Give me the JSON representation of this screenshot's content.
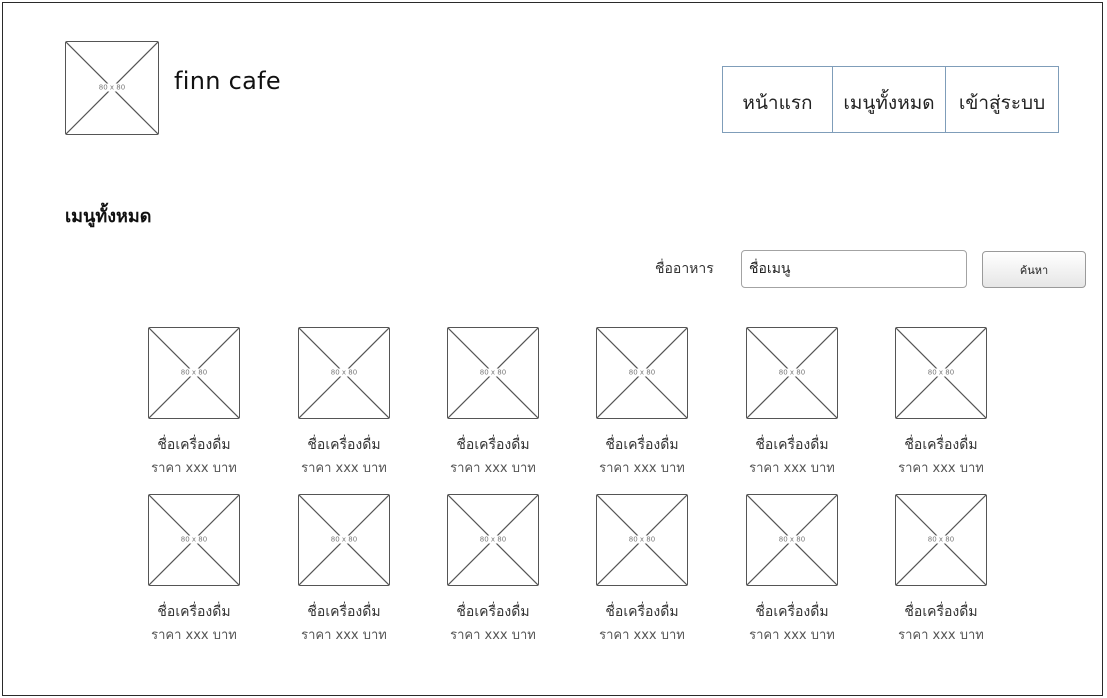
{
  "header": {
    "logo_placeholder": "80 x 80",
    "brand": "finn cafe",
    "nav": [
      {
        "label": "หน้าแรก"
      },
      {
        "label": "เมนูทั้งหมด"
      },
      {
        "label": "เข้าสู่ระบบ"
      }
    ]
  },
  "main": {
    "title": "เมนูทั้งหมด",
    "search": {
      "label": "ชื่ออาหาร",
      "value": "ชื่อเมนู",
      "button_label": "ค้นหา"
    },
    "items": [
      {
        "image": "80 x 80",
        "name": "ชื่อเครื่องดื่ม",
        "price": "ราคา xxx บาท"
      },
      {
        "image": "80 x 80",
        "name": "ชื่อเครื่องดื่ม",
        "price": "ราคา xxx บาท"
      },
      {
        "image": "80 x 80",
        "name": "ชื่อเครื่องดื่ม",
        "price": "ราคา xxx บาท"
      },
      {
        "image": "80 x 80",
        "name": "ชื่อเครื่องดื่ม",
        "price": "ราคา xxx บาท"
      },
      {
        "image": "80 x 80",
        "name": "ชื่อเครื่องดื่ม",
        "price": "ราคา xxx บาท"
      },
      {
        "image": "80 x 80",
        "name": "ชื่อเครื่องดื่ม",
        "price": "ราคา xxx บาท"
      },
      {
        "image": "80 x 80",
        "name": "ชื่อเครื่องดื่ม",
        "price": "ราคา xxx บาท"
      },
      {
        "image": "80 x 80",
        "name": "ชื่อเครื่องดื่ม",
        "price": "ราคา xxx บาท"
      },
      {
        "image": "80 x 80",
        "name": "ชื่อเครื่องดื่ม",
        "price": "ราคา xxx บาท"
      },
      {
        "image": "80 x 80",
        "name": "ชื่อเครื่องดื่ม",
        "price": "ราคา xxx บาท"
      },
      {
        "image": "80 x 80",
        "name": "ชื่อเครื่องดื่ม",
        "price": "ราคา xxx บาท"
      },
      {
        "image": "80 x 80",
        "name": "ชื่อเครื่องดื่ม",
        "price": "ราคา xxx บาท"
      }
    ]
  }
}
